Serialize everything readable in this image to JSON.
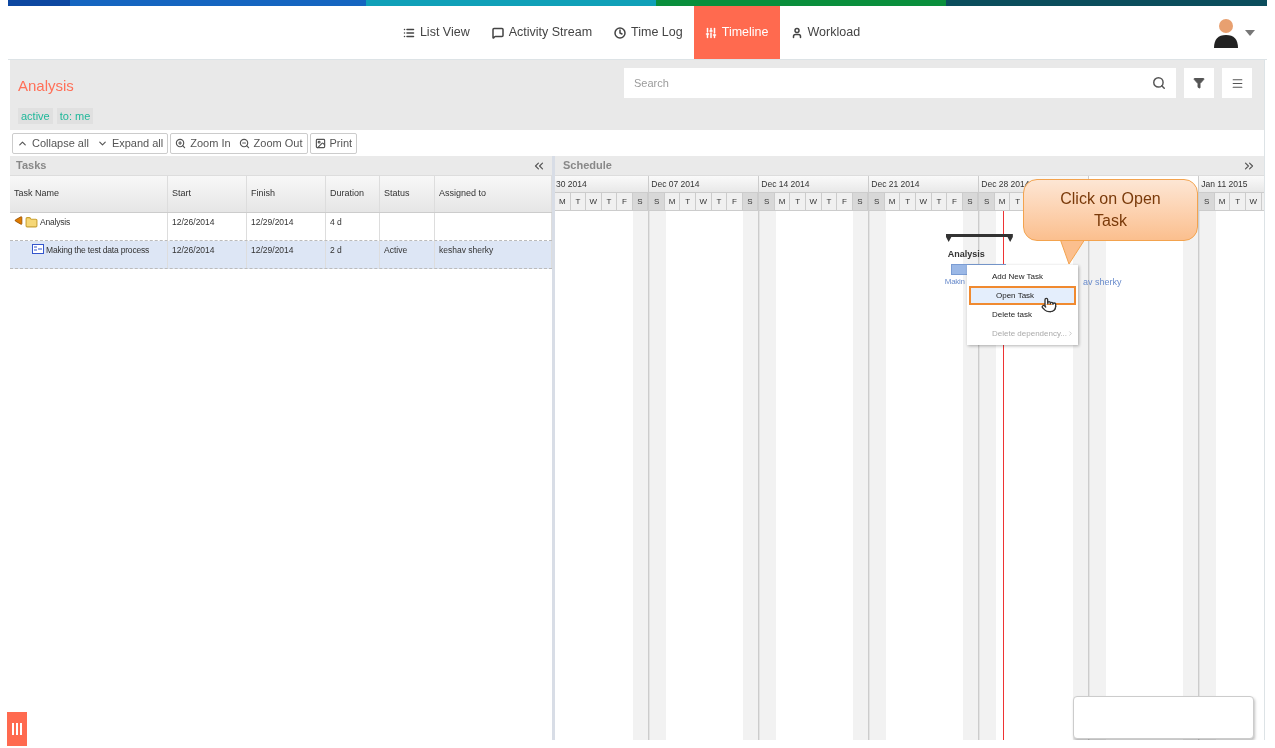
{
  "nav": {
    "tabs": [
      {
        "label": "List View",
        "selected": false
      },
      {
        "label": "Activity Stream",
        "selected": false
      },
      {
        "label": "Time Log",
        "selected": false
      },
      {
        "label": "Timeline",
        "selected": true
      },
      {
        "label": "Workload",
        "selected": false
      }
    ]
  },
  "project": {
    "title": "Analysis",
    "filters": [
      "active",
      "to: me"
    ],
    "search": {
      "placeholder": "Search"
    }
  },
  "toolbar": {
    "groups": [
      [
        "Collapse all",
        "Expand all"
      ],
      [
        "Zoom In",
        "Zoom Out"
      ],
      [
        "Print"
      ]
    ]
  },
  "tasks_panel": {
    "title": "Tasks",
    "columns": [
      "Task Name",
      "Start",
      "Finish",
      "Duration",
      "Status",
      "Assigned to"
    ],
    "rows": [
      {
        "name": "Analysis",
        "start": "12/26/2014",
        "finish": "12/29/2014",
        "duration": "4 d",
        "selected": false,
        "children": [
          {
            "name": "Making the test data process",
            "start": "12/26/2014",
            "finish": "12/29/2014",
            "duration": "2 d",
            "status": "Active",
            "assigned": "keshav sherky",
            "selected": true
          }
        ]
      }
    ]
  },
  "schedule_panel": {
    "title": "Schedule",
    "weeks": [
      {
        "label": "30 2014",
        "cut": true,
        "days": [
          "M",
          "T",
          "W",
          "T",
          "F",
          "S"
        ]
      },
      {
        "label": "Dec 07 2014",
        "days": [
          "S",
          "M",
          "T",
          "W",
          "T",
          "F",
          "S"
        ]
      },
      {
        "label": "Dec 14 2014",
        "days": [
          "S",
          "M",
          "T",
          "W",
          "T",
          "F",
          "S"
        ]
      },
      {
        "label": "Dec 21 2014",
        "days": [
          "S",
          "M",
          "T",
          "W",
          "T",
          "F",
          "S"
        ]
      },
      {
        "label": "Dec 28 2014",
        "days": [
          "S",
          "M",
          "T"
        ]
      },
      {
        "covered": true
      },
      {
        "label": "Jan 11 2015",
        "days": [
          "S",
          "M",
          "T",
          "W"
        ]
      }
    ],
    "summary_label": "Analysis",
    "bar_label_left": "Makin",
    "bar_label_right": "av sherky",
    "context_menu": [
      {
        "label": "Add New Task",
        "selected": false,
        "disabled": false
      },
      {
        "label": "Open Task",
        "selected": true,
        "disabled": false
      },
      {
        "label": "Delete task",
        "selected": false,
        "disabled": false
      },
      {
        "label": "Delete dependency...",
        "selected": false,
        "disabled": true
      }
    ],
    "callout": "Click on Open Task"
  }
}
